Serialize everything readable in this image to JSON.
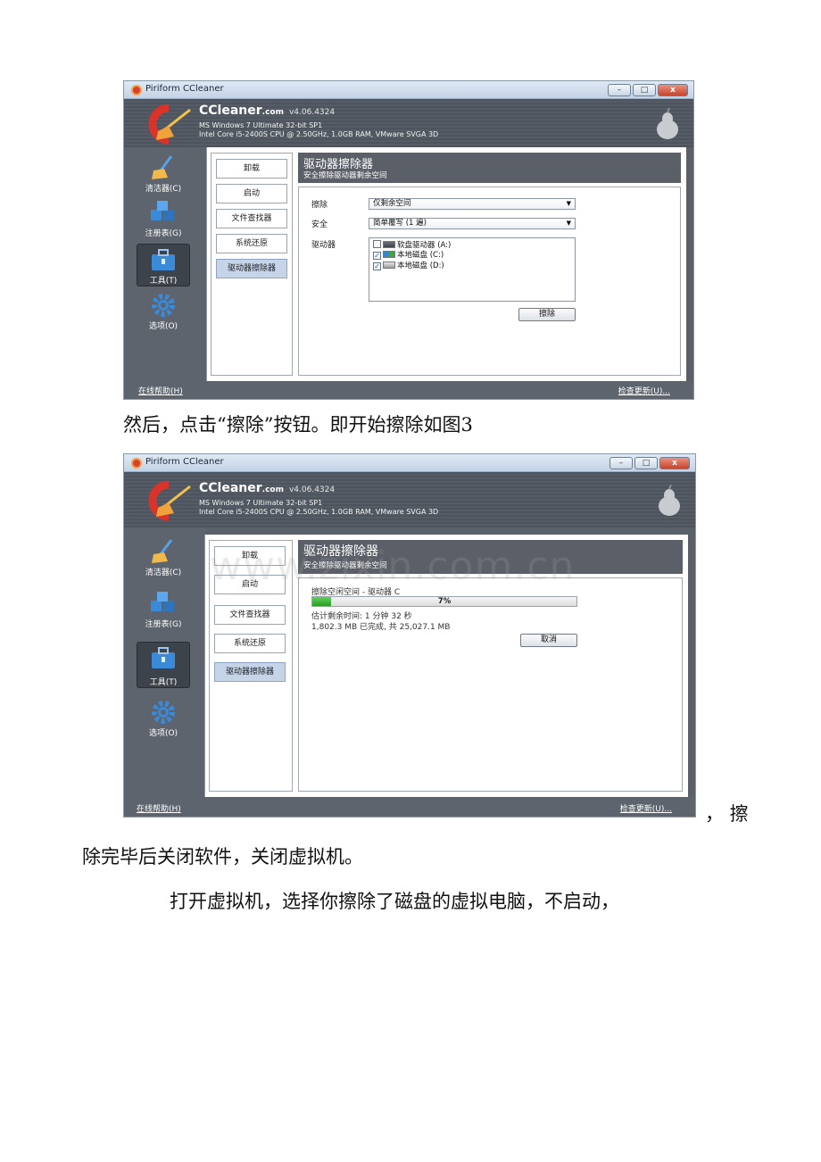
{
  "app": {
    "title": "Piriform CCleaner",
    "brand": "CCleaner",
    "brand_suffix": ".com",
    "version": "v4.06.4324",
    "sys_line1": "MS Windows 7 Ultimate 32-bit SP1",
    "sys_line2": "Intel Core i5-2400S CPU @ 2.50GHz, 1.0GB RAM, VMware SVGA 3D",
    "window_buttons": {
      "minimize": "–",
      "maximize": "□",
      "close": "x"
    }
  },
  "sidebar": [
    {
      "label": "清洁器(C)"
    },
    {
      "label": "注册表(G)"
    },
    {
      "label": "工具(T)"
    },
    {
      "label": "选项(O)"
    }
  ],
  "tools": [
    {
      "label": "卸载"
    },
    {
      "label": "启动"
    },
    {
      "label": "文件查找器"
    },
    {
      "label": "系统还原"
    },
    {
      "label": "驱动器擦除器"
    }
  ],
  "wiper": {
    "title": "驱动器擦除器",
    "subtitle": "安全擦除驱动器剩余空间",
    "wipe_label": "擦除",
    "wipe_value": "仅剩余空间",
    "security_label": "安全",
    "security_value": "简单覆写 (1 遍)",
    "drives_label": "驱动器",
    "drives": [
      {
        "label": "软盘驱动器 (A:)",
        "checked": false
      },
      {
        "label": "本地磁盘 (C:)",
        "checked": true
      },
      {
        "label": "本地磁盘 (D:)",
        "checked": true
      }
    ],
    "wipe_button": "擦除"
  },
  "progress": {
    "caption": "擦除空闲空间 - 驱动器 C",
    "percent": 7,
    "percent_text": "7%",
    "eta": "估计剩余时间: 1 分钟 32 秒",
    "done": "1,802.3 MB 已完成, 共 25,027.1 MB",
    "cancel_button": "取消"
  },
  "footer": {
    "help_link": "在线帮助(H)",
    "update_link": "检查更新(U)..."
  },
  "document": {
    "line1": "然后，点击“擦除”按钮。即开始擦除如图3",
    "trailing": "， 擦",
    "line2": "除完毕后关闭软件，关闭虚拟机。",
    "line3": "打开虚拟机，选择你擦除了磁盘的虚拟电脑，不启动，"
  },
  "watermark": "www.zixin.com.cn"
}
